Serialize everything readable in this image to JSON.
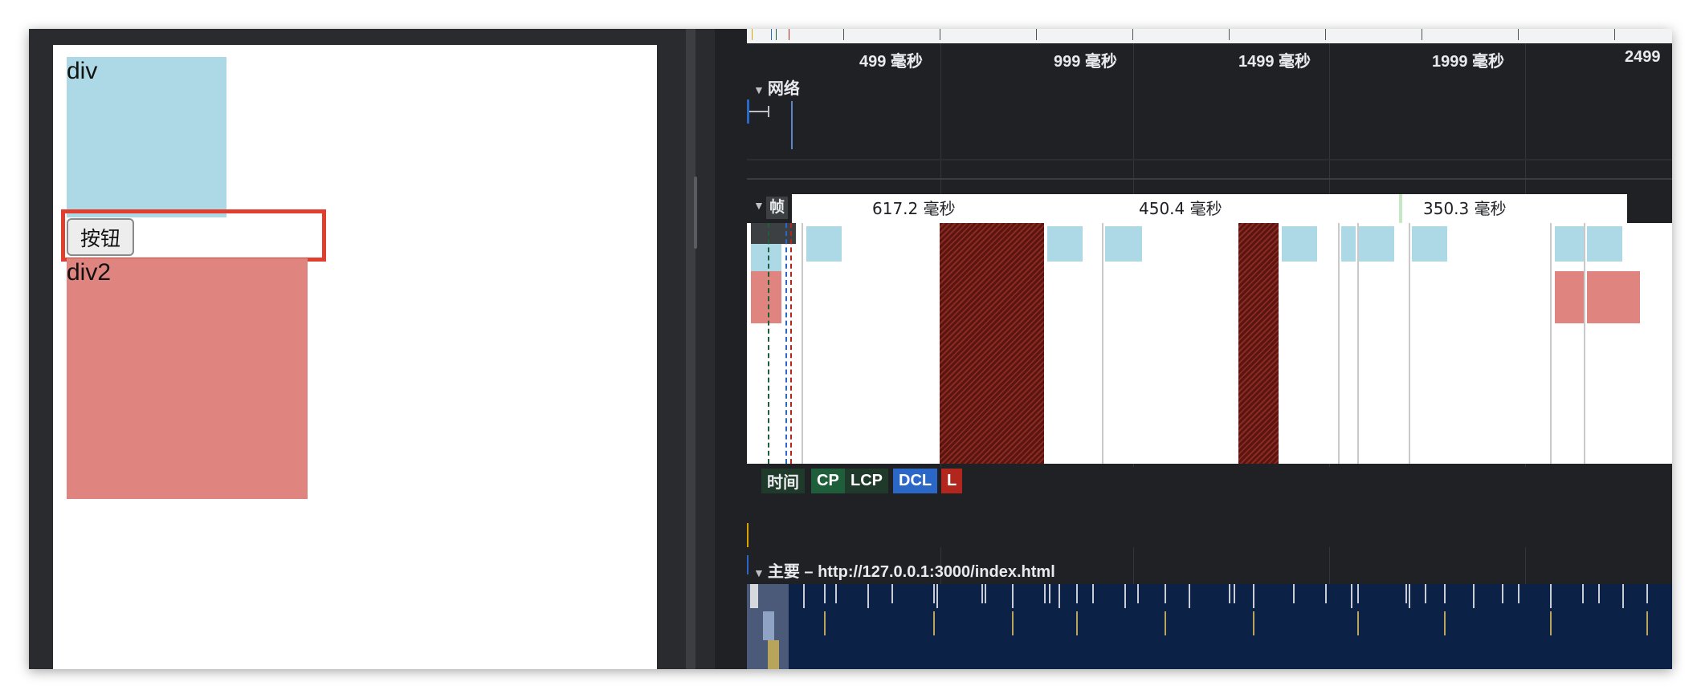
{
  "page_preview": {
    "div1_label": "div",
    "button_label": "按钮",
    "div2_label": "div2",
    "div1_color": "#add8e6",
    "div2_color": "#e08480",
    "highlight_color": "#e23e2f"
  },
  "performance": {
    "time_ticks": [
      "499 毫秒",
      "999 毫秒",
      "1499 毫秒",
      "1999 毫秒",
      "2499"
    ],
    "tracks": {
      "network": {
        "label": "网络",
        "expand_icon": "triangle-down-icon"
      },
      "frames": {
        "label": "帧",
        "durations": [
          "617.2 毫秒",
          "450.4 毫秒",
          "350.3 毫秒"
        ]
      },
      "timings": {
        "label": "时间",
        "markers": [
          "CP",
          "LCP",
          "DCL",
          "L"
        ]
      },
      "main": {
        "label": "主要 – http://127.0.0.1:3000/index.html"
      }
    },
    "colors": {
      "fcp": "#1e5e3a",
      "lcp": "#1f3a2a",
      "dcl": "#2b67c7",
      "load": "#b3261e",
      "main_bg": "#0c2146"
    }
  }
}
